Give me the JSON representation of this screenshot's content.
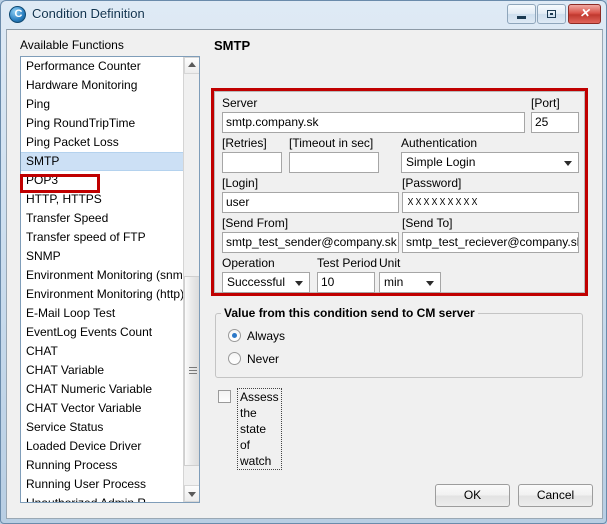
{
  "window": {
    "title": "Condition Definition",
    "icon": "app-circle-icon",
    "controls": {
      "minimize": "minimize-icon",
      "maximize": "maximize-icon",
      "close": "✕"
    }
  },
  "sidebar": {
    "label": "Available Functions",
    "selected": "SMTP",
    "items": [
      "Performance Counter",
      "Hardware Monitoring",
      "Ping",
      "Ping RoundTripTime",
      "Ping Packet Loss",
      "SMTP",
      "POP3",
      "HTTP, HTTPS",
      "Transfer Speed",
      "Transfer speed of FTP",
      "SNMP",
      "Environment Monitoring (snmp)",
      "Environment Monitoring (http)",
      "E-Mail Loop Test",
      "EventLog Events Count",
      "CHAT",
      "CHAT Variable",
      "CHAT Numeric Variable",
      "CHAT Vector Variable",
      "Service Status",
      "Loaded Device Driver",
      "Running Process",
      "Running User Process",
      "Unauthorized Admin R"
    ]
  },
  "main": {
    "heading": "SMTP",
    "fields": {
      "server": {
        "label": "Server",
        "value": "smtp.company.sk"
      },
      "port": {
        "label": "[Port]",
        "value": "25"
      },
      "retries": {
        "label": "[Retries]",
        "value": ""
      },
      "timeout": {
        "label": "[Timeout in sec]",
        "value": ""
      },
      "authentication": {
        "label": "Authentication",
        "value": "Simple Login"
      },
      "login": {
        "label": "[Login]",
        "value": "user"
      },
      "password": {
        "label": "[Password]",
        "value": "ＸＸＸＸＸＸＸＸＸ"
      },
      "send_from": {
        "label": "[Send From]",
        "value": "smtp_test_sender@company.sk"
      },
      "send_to": {
        "label": "[Send To]",
        "value": "smtp_test_reciever@company.sk"
      },
      "operation": {
        "label": "Operation",
        "value": "Successful"
      },
      "test_period": {
        "label": "Test Period",
        "value": "10"
      },
      "unit": {
        "label": "Unit",
        "value": "min"
      }
    },
    "group": {
      "title": "Value from this condition send to CM server",
      "options": [
        {
          "label": "Always",
          "selected": true
        },
        {
          "label": "Never",
          "selected": false
        }
      ]
    },
    "checkbox": {
      "label": "Assess the state of watch",
      "checked": false
    }
  },
  "footer": {
    "ok": "OK",
    "cancel": "Cancel"
  },
  "colors": {
    "annotation": "#c00000",
    "selection": "#cce0f5",
    "radio_accent": "#2b78c8",
    "window_bg": "#f0f0f0"
  }
}
